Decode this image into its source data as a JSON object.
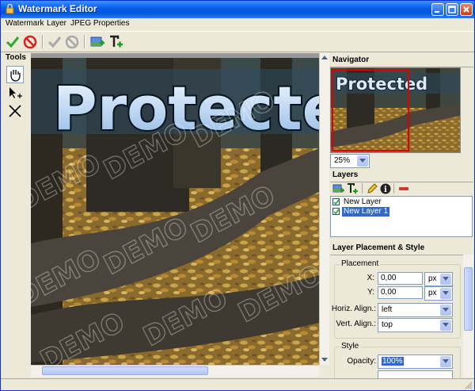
{
  "window": {
    "title": "Watermark Editor"
  },
  "menu": [
    "Watermark",
    "Layer",
    "JPEG Properties"
  ],
  "tools": {
    "label": "Tools"
  },
  "canvas": {
    "watermark_text": "Protecte",
    "demo_text": "DEMO"
  },
  "navigator": {
    "title": "Navigator",
    "preview_text": "Protected",
    "zoom": "25%"
  },
  "layers": {
    "title": "Layers",
    "items": [
      {
        "name": "New Layer",
        "checked": true
      },
      {
        "name": "New Layer 1",
        "checked": true,
        "selected": true
      }
    ]
  },
  "placement": {
    "title": "Layer Placement & Style",
    "group_label": "Placement",
    "x_label": "X:",
    "x_value": "0,00",
    "x_unit": "px",
    "y_label": "Y:",
    "y_value": "0,00",
    "y_unit": "px",
    "halign_label": "Horiz. Align.:",
    "halign_value": "left",
    "valign_label": "Vert. Align.:",
    "valign_value": "top"
  },
  "style": {
    "group_label": "Style",
    "opacity_label": "Opacity:",
    "opacity_value": "100%"
  },
  "colors": {
    "titlebar": "#0A5EE8",
    "selection": "#316AC5",
    "face": "#ECE9D8",
    "nav_frame": "#E00000"
  }
}
